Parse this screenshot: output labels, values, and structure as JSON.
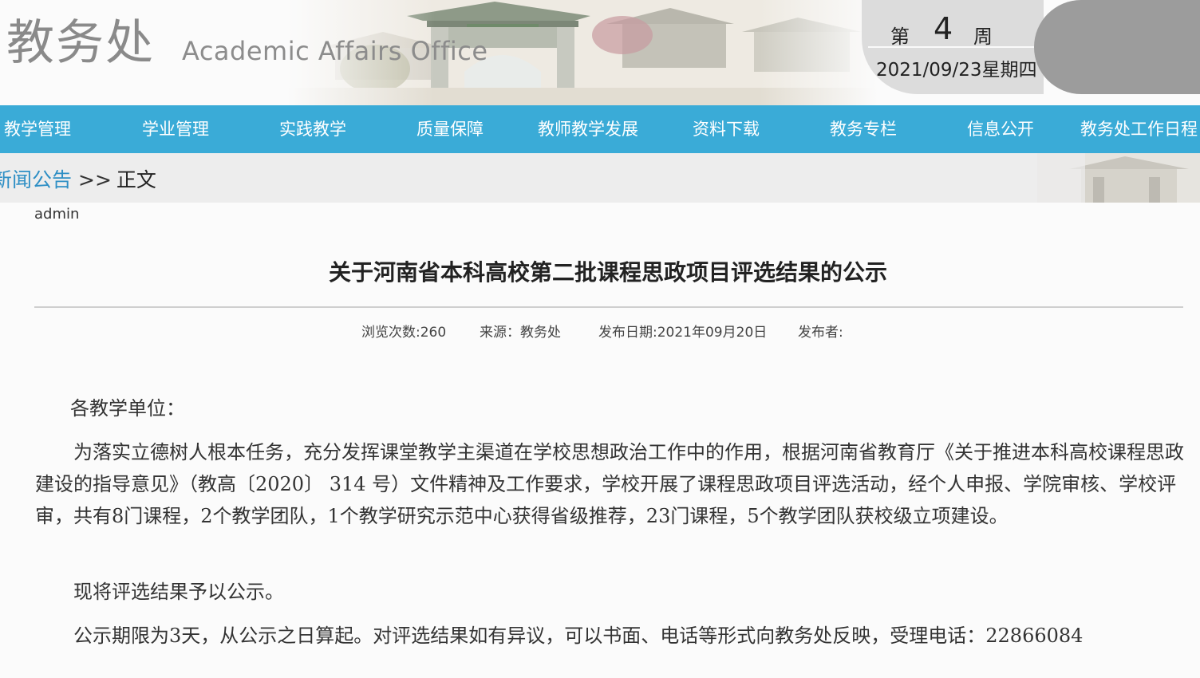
{
  "header": {
    "logo_cn": "教务处",
    "logo_en": "Academic Affairs Office",
    "week_prefix": "第",
    "week_number": "4",
    "week_suffix": "周",
    "date": "2021/09/23星期四"
  },
  "nav": {
    "items": [
      {
        "label": "教学管理"
      },
      {
        "label": "学业管理"
      },
      {
        "label": "实践教学"
      },
      {
        "label": "质量保障"
      },
      {
        "label": "教师教学发展"
      },
      {
        "label": "资料下载"
      },
      {
        "label": "教务专栏"
      },
      {
        "label": "信息公开"
      },
      {
        "label": "教务处工作日程"
      }
    ],
    "color": "#3aabd7"
  },
  "breadcrumb": {
    "link": "新闻公告",
    "separator": ">>",
    "current": "正文"
  },
  "article": {
    "author": "admin",
    "title": "关于河南省本科高校第二批课程思政项目评选结果的公示",
    "views": "浏览次数:260",
    "source": "来源：教务处",
    "publish_date": "发布日期:2021年09月20日",
    "publisher": "发布者:",
    "greeting": "各教学单位：",
    "paragraph1": "为落实立德树人根本任务，充分发挥课堂教学主渠道在学校思想政治工作中的作用，根据河南省教育厅《关于推进本科高校课程思政建设的指导意见》（教高〔2020〕 314 号）文件精神及工作要求，学校开展了课程思政项目评选活动，经个人申报、学院审核、学校评审，共有8门课程，2个教学团队，1个教学研究示范中心获得省级推荐，23门课程，5个教学团队获校级立项建设。",
    "paragraph2": "现将评选结果予以公示。",
    "paragraph3": "公示期限为3天，从公示之日算起。对评选结果如有异议，可以书面、电话等形式向教务处反映，受理电话：22866084"
  }
}
